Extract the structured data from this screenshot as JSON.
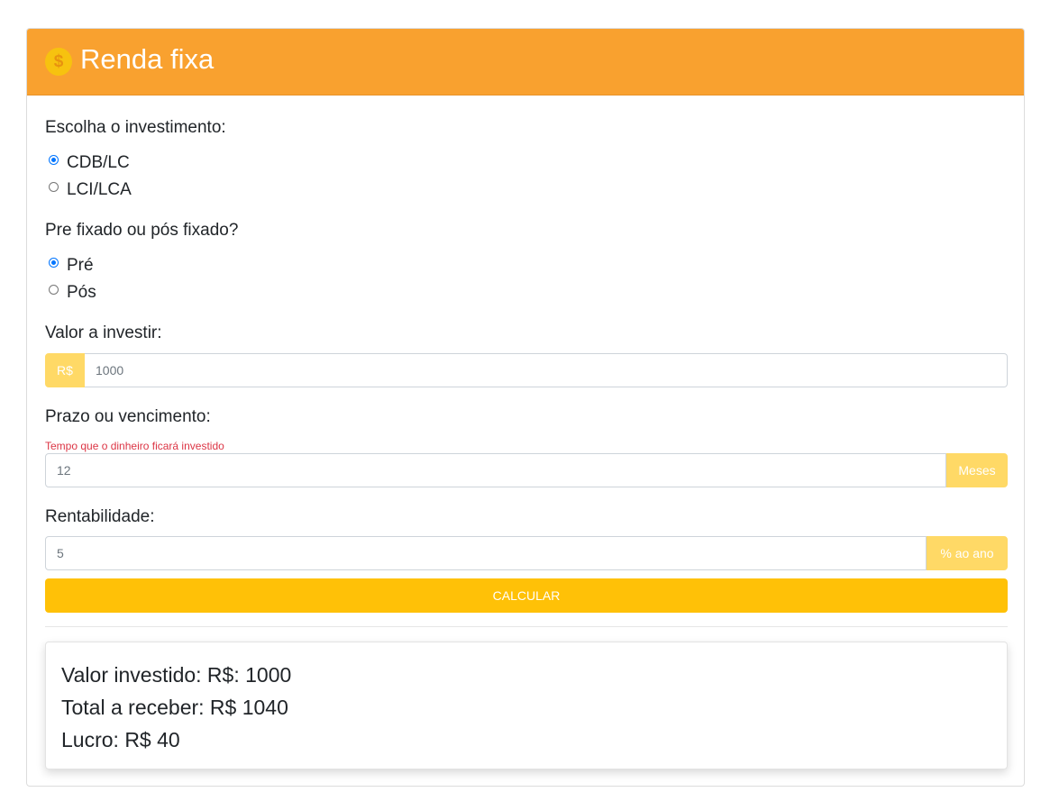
{
  "header": {
    "icon": "dollar-coin-icon",
    "icon_glyph": "$",
    "title": "Renda fixa"
  },
  "investment": {
    "label": "Escolha o investimento:",
    "options": [
      {
        "label": "CDB/LC",
        "checked": true
      },
      {
        "label": "LCI/LCA",
        "checked": false
      }
    ]
  },
  "rate_type": {
    "label": "Pre fixado ou pós fixado?",
    "options": [
      {
        "label": "Pré",
        "checked": true
      },
      {
        "label": "Pós",
        "checked": false
      }
    ]
  },
  "amount": {
    "label": "Valor a investir:",
    "prefix": "R$",
    "value": "1000"
  },
  "term": {
    "label": "Prazo ou vencimento:",
    "hint": "Tempo que o dinheiro ficará investido",
    "value": "12",
    "suffix": "Meses"
  },
  "yield": {
    "label": "Rentabilidade:",
    "value": "5",
    "suffix": "% ao ano"
  },
  "calculate_label": "CALCULAR",
  "results": {
    "invested": "Valor investido: R$: 1000",
    "total": "Total a receber: R$ 1040",
    "profit": "Lucro: R$ 40"
  },
  "colors": {
    "header_bg": "#f9a12f",
    "addon_bg": "#ffd966",
    "button_bg": "#ffc107",
    "hint_text": "#dc3545",
    "radio_checked": "#0075ff"
  }
}
